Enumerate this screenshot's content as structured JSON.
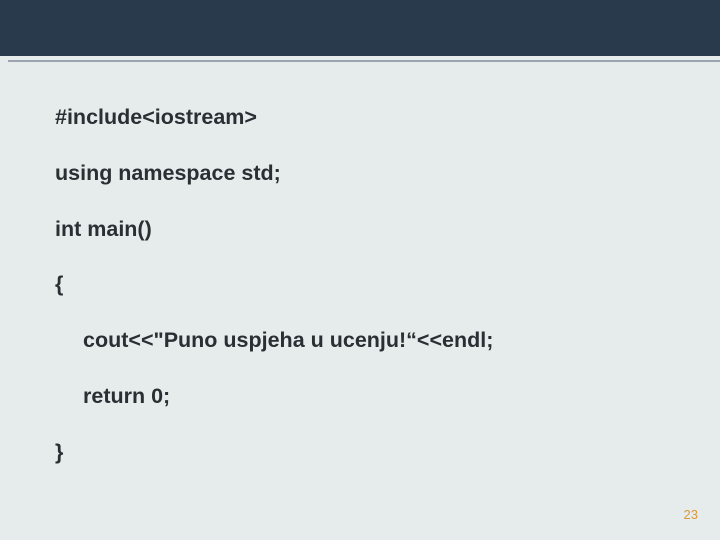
{
  "code": {
    "line1": "#include<iostream>",
    "line2": "using namespace std;",
    "line3": "int main()",
    "line4": "{",
    "line5": "cout<<\"Puno uspjeha u ucenju!“<<endl;",
    "line6": "return 0;",
    "line7": "}"
  },
  "page_number": "23"
}
